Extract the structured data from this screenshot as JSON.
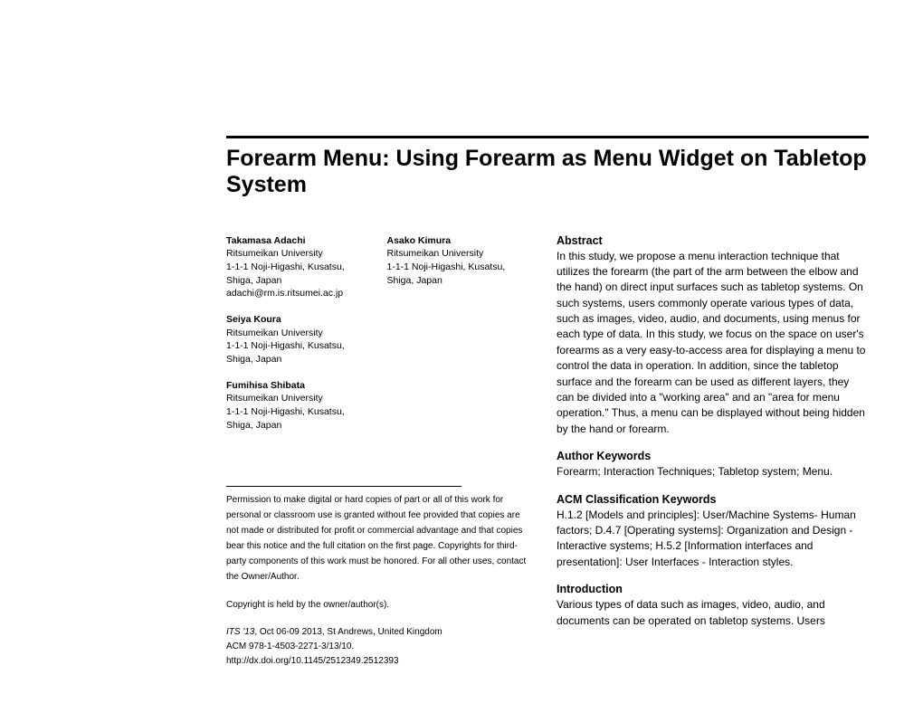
{
  "title": "Forearm Menu: Using Forearm as Menu Widget on Tabletop System",
  "authors": [
    {
      "name": "Takamasa Adachi",
      "affiliation": "Ritsumeikan University",
      "address1": "1-1-1 Noji-Higashi, Kusatsu,",
      "address2": "Shiga, Japan",
      "email": "adachi@rm.is.ritsumei.ac.jp"
    },
    {
      "name": "Asako Kimura",
      "affiliation": "Ritsumeikan University",
      "address1": "1-1-1 Noji-Higashi, Kusatsu,",
      "address2": "Shiga, Japan",
      "email": ""
    },
    {
      "name": "Seiya Koura",
      "affiliation": "Ritsumeikan University",
      "address1": "1-1-1 Noji-Higashi, Kusatsu,",
      "address2": "Shiga, Japan",
      "email": ""
    },
    {
      "name": "Fumihisa Shibata",
      "affiliation": "Ritsumeikan University",
      "address1": "1-1-1 Noji-Higashi, Kusatsu,",
      "address2": "Shiga, Japan",
      "email": ""
    }
  ],
  "permission": "Permission to make digital or hard copies of part or all of this work for personal or classroom use is granted without fee provided that copies are not made or distributed for profit or commercial advantage and that copies bear this notice and the full citation on the first page. Copyrights for third-party components of this work must be honored. For all other uses, contact the Owner/Author.",
  "copyright": "Copyright is held by the owner/author(s).",
  "conference": {
    "name": "ITS '13",
    "details": ", Oct 06-09 2013, St Andrews, United Kingdom",
    "acm": "ACM 978-1-4503-2271-3/13/10.",
    "doi": "http://dx.doi.org/10.1145/2512349.2512393"
  },
  "sections": {
    "abstract_heading": "Abstract",
    "abstract_body": "In this study, we propose a menu interaction technique that utilizes the forearm (the part of the arm between the elbow and the hand) on direct input surfaces such as tabletop systems. On such systems, users commonly operate various types of data, such as images, video, audio, and documents, using menus for each type of data. In this study, we focus on the space on user's forearms as a very easy-to-access area for displaying a menu to control the data in operation. In addition, since the tabletop surface and the forearm can be used as different layers, they can be divided into a \"working area\" and an \"area for menu operation.\" Thus, a menu can be displayed without being hidden by the hand or forearm.",
    "keywords_heading": "Author Keywords",
    "keywords_body": "Forearm; Interaction Techniques; Tabletop system; Menu.",
    "acm_heading": "ACM Classification Keywords",
    "acm_body": "H.1.2 [Models and principles]: User/Machine Systems- Human factors; D.4.7 [Operating systems]: Organization and Design - Interactive systems; H.5.2 [Information interfaces and presentation]: User Interfaces - Interaction styles.",
    "intro_heading": "Introduction",
    "intro_body": "Various types of data such as images, video, audio, and documents can be operated on tabletop systems. Users"
  }
}
